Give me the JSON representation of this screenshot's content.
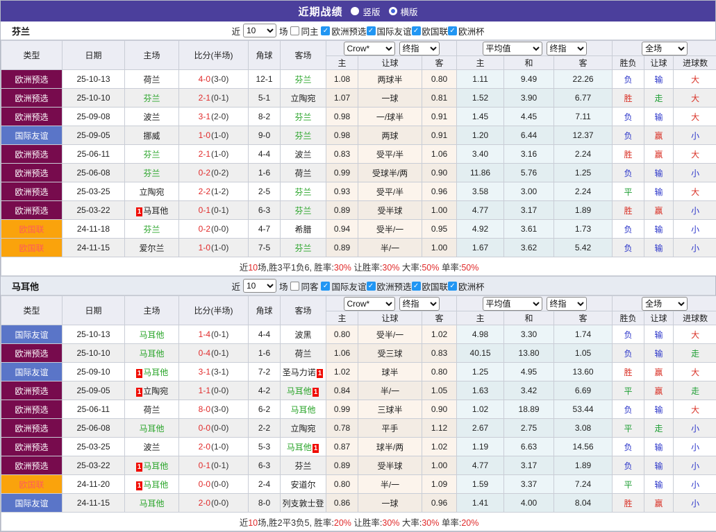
{
  "title_bar": {
    "title": "近期战绩",
    "layout_options": [
      {
        "label": "竖版",
        "selected": true
      },
      {
        "label": "横版",
        "selected": false
      }
    ]
  },
  "colors": {
    "bar_purple": "#4B3F9C",
    "league_maroon": "#770B4D",
    "league_blue": "#5A75C8",
    "league_orange": "#FAA30C",
    "league_orange_text": "#FF5B5B",
    "focus_team_green": "#28A428",
    "score_red": "#E02A2A",
    "win_red": "#D93025",
    "draw_green": "#1E9E33",
    "lose_blue": "#2B35C9",
    "checkbox_blue": "#2196F3"
  },
  "table_header": {
    "col_type": "类型",
    "col_date": "日期",
    "col_home": "主场",
    "col_score": "比分(半场)",
    "col_corner": "角球",
    "col_away": "客场",
    "dd_crow": "Crow*",
    "dd_final1": "终指",
    "dd_avg": "平均值",
    "dd_final2": "终指",
    "dd_fulltime": "全场",
    "sub": [
      "主",
      "让球",
      "客",
      "主",
      "和",
      "客",
      "胜负",
      "让球",
      "进球数"
    ]
  },
  "sections": [
    {
      "team": "芬兰",
      "filter": {
        "near_label": "近",
        "games_value": "10",
        "games_suffix": "场",
        "same_label": "同主",
        "same_checked": false,
        "leagues": [
          {
            "label": "欧洲预选",
            "checked": true
          },
          {
            "label": "国际友谊",
            "checked": true
          },
          {
            "label": "欧国联",
            "checked": true
          },
          {
            "label": "欧洲杯",
            "checked": true
          }
        ]
      },
      "rows": [
        {
          "league": "欧洲预选",
          "league_style": "maroon",
          "date": "25-10-13",
          "home": "荷兰",
          "home_focus": false,
          "home_card": 0,
          "score": "4-0",
          "half": "(3-0)",
          "corners": "12-1",
          "away": "芬兰",
          "away_focus": true,
          "away_card": 0,
          "crow": [
            "1.08",
            "两球半",
            "0.80"
          ],
          "avg": [
            "1.11",
            "9.49",
            "22.26"
          ],
          "outcome": [
            "负",
            "输",
            "大"
          ]
        },
        {
          "league": "欧洲预选",
          "league_style": "maroon",
          "date": "25-10-10",
          "home": "芬兰",
          "home_focus": true,
          "home_card": 0,
          "score": "2-1",
          "half": "(0-1)",
          "corners": "5-1",
          "away": "立陶宛",
          "away_focus": false,
          "away_card": 0,
          "crow": [
            "1.07",
            "一球",
            "0.81"
          ],
          "avg": [
            "1.52",
            "3.90",
            "6.77"
          ],
          "outcome": [
            "胜",
            "走",
            "大"
          ]
        },
        {
          "league": "欧洲预选",
          "league_style": "maroon",
          "date": "25-09-08",
          "home": "波兰",
          "home_focus": false,
          "home_card": 0,
          "score": "3-1",
          "half": "(2-0)",
          "corners": "8-2",
          "away": "芬兰",
          "away_focus": true,
          "away_card": 0,
          "crow": [
            "0.98",
            "一/球半",
            "0.91"
          ],
          "avg": [
            "1.45",
            "4.45",
            "7.11"
          ],
          "outcome": [
            "负",
            "输",
            "大"
          ]
        },
        {
          "league": "国际友谊",
          "league_style": "blue",
          "date": "25-09-05",
          "home": "挪威",
          "home_focus": false,
          "home_card": 0,
          "score": "1-0",
          "half": "(1-0)",
          "corners": "9-0",
          "away": "芬兰",
          "away_focus": true,
          "away_card": 0,
          "crow": [
            "0.98",
            "两球",
            "0.91"
          ],
          "avg": [
            "1.20",
            "6.44",
            "12.37"
          ],
          "outcome": [
            "负",
            "赢",
            "小"
          ]
        },
        {
          "league": "欧洲预选",
          "league_style": "maroon",
          "date": "25-06-11",
          "home": "芬兰",
          "home_focus": true,
          "home_card": 0,
          "score": "2-1",
          "half": "(1-0)",
          "corners": "4-4",
          "away": "波兰",
          "away_focus": false,
          "away_card": 0,
          "crow": [
            "0.83",
            "受平/半",
            "1.06"
          ],
          "avg": [
            "3.40",
            "3.16",
            "2.24"
          ],
          "outcome": [
            "胜",
            "赢",
            "大"
          ]
        },
        {
          "league": "欧洲预选",
          "league_style": "maroon",
          "date": "25-06-08",
          "home": "芬兰",
          "home_focus": true,
          "home_card": 0,
          "score": "0-2",
          "half": "(0-2)",
          "corners": "1-6",
          "away": "荷兰",
          "away_focus": false,
          "away_card": 0,
          "crow": [
            "0.99",
            "受球半/两",
            "0.90"
          ],
          "avg": [
            "11.86",
            "5.76",
            "1.25"
          ],
          "outcome": [
            "负",
            "输",
            "小"
          ]
        },
        {
          "league": "欧洲预选",
          "league_style": "maroon",
          "date": "25-03-25",
          "home": "立陶宛",
          "home_focus": false,
          "home_card": 0,
          "score": "2-2",
          "half": "(1-2)",
          "corners": "2-5",
          "away": "芬兰",
          "away_focus": true,
          "away_card": 0,
          "crow": [
            "0.93",
            "受平/半",
            "0.96"
          ],
          "avg": [
            "3.58",
            "3.00",
            "2.24"
          ],
          "outcome": [
            "平",
            "输",
            "大"
          ]
        },
        {
          "league": "欧洲预选",
          "league_style": "maroon",
          "date": "25-03-22",
          "home": "马耳他",
          "home_focus": false,
          "home_card": 1,
          "score": "0-1",
          "half": "(0-1)",
          "corners": "6-3",
          "away": "芬兰",
          "away_focus": true,
          "away_card": 0,
          "crow": [
            "0.89",
            "受半球",
            "1.00"
          ],
          "avg": [
            "4.77",
            "3.17",
            "1.89"
          ],
          "outcome": [
            "胜",
            "赢",
            "小"
          ]
        },
        {
          "league": "欧国联",
          "league_style": "orange",
          "date": "24-11-18",
          "home": "芬兰",
          "home_focus": true,
          "home_card": 0,
          "score": "0-2",
          "half": "(0-0)",
          "corners": "4-7",
          "away": "希腊",
          "away_focus": false,
          "away_card": 0,
          "crow": [
            "0.94",
            "受半/一",
            "0.95"
          ],
          "avg": [
            "4.92",
            "3.61",
            "1.73"
          ],
          "outcome": [
            "负",
            "输",
            "小"
          ]
        },
        {
          "league": "欧国联",
          "league_style": "orange",
          "date": "24-11-15",
          "home": "爱尔兰",
          "home_focus": false,
          "home_card": 0,
          "score": "1-0",
          "half": "(1-0)",
          "corners": "7-5",
          "away": "芬兰",
          "away_focus": true,
          "away_card": 0,
          "crow": [
            "0.89",
            "半/一",
            "1.00"
          ],
          "avg": [
            "1.67",
            "3.62",
            "5.42"
          ],
          "outcome": [
            "负",
            "输",
            "小"
          ]
        }
      ],
      "summary": [
        [
          "近",
          false
        ],
        [
          "10",
          true
        ],
        [
          "场,胜3平1负6, 胜率:",
          false
        ],
        [
          "30%",
          true
        ],
        [
          " 让胜率:",
          false
        ],
        [
          "30%",
          true
        ],
        [
          " 大率:",
          false
        ],
        [
          "50%",
          true
        ],
        [
          " 单率:",
          false
        ],
        [
          "50%",
          true
        ]
      ]
    },
    {
      "team": "马耳他",
      "filter": {
        "near_label": "近",
        "games_value": "10",
        "games_suffix": "场",
        "same_label": "同客",
        "same_checked": false,
        "leagues": [
          {
            "label": "国际友谊",
            "checked": true
          },
          {
            "label": "欧洲预选",
            "checked": true
          },
          {
            "label": "欧国联",
            "checked": true
          },
          {
            "label": "欧洲杯",
            "checked": true
          }
        ]
      },
      "rows": [
        {
          "league": "国际友谊",
          "league_style": "blue",
          "date": "25-10-13",
          "home": "马耳他",
          "home_focus": true,
          "home_card": 0,
          "score": "1-4",
          "half": "(0-1)",
          "corners": "4-4",
          "away": "波黑",
          "away_focus": false,
          "away_card": 0,
          "crow": [
            "0.80",
            "受半/一",
            "1.02"
          ],
          "avg": [
            "4.98",
            "3.30",
            "1.74"
          ],
          "outcome": [
            "负",
            "输",
            "大"
          ]
        },
        {
          "league": "欧洲预选",
          "league_style": "maroon",
          "date": "25-10-10",
          "home": "马耳他",
          "home_focus": true,
          "home_card": 0,
          "score": "0-4",
          "half": "(0-1)",
          "corners": "1-6",
          "away": "荷兰",
          "away_focus": false,
          "away_card": 0,
          "crow": [
            "1.06",
            "受三球",
            "0.83"
          ],
          "avg": [
            "40.15",
            "13.80",
            "1.05"
          ],
          "outcome": [
            "负",
            "输",
            "走"
          ]
        },
        {
          "league": "国际友谊",
          "league_style": "blue",
          "date": "25-09-10",
          "home": "马耳他",
          "home_focus": true,
          "home_card": 1,
          "score": "3-1",
          "half": "(3-1)",
          "corners": "7-2",
          "away": "圣马力诺",
          "away_focus": false,
          "away_card": 1,
          "crow": [
            "1.02",
            "球半",
            "0.80"
          ],
          "avg": [
            "1.25",
            "4.95",
            "13.60"
          ],
          "outcome": [
            "胜",
            "赢",
            "大"
          ]
        },
        {
          "league": "欧洲预选",
          "league_style": "maroon",
          "date": "25-09-05",
          "home": "立陶宛",
          "home_focus": false,
          "home_card": 1,
          "score": "1-1",
          "half": "(0-0)",
          "corners": "4-2",
          "away": "马耳他",
          "away_focus": true,
          "away_card": 1,
          "crow": [
            "0.84",
            "半/一",
            "1.05"
          ],
          "avg": [
            "1.63",
            "3.42",
            "6.69"
          ],
          "outcome": [
            "平",
            "赢",
            "走"
          ]
        },
        {
          "league": "欧洲预选",
          "league_style": "maroon",
          "date": "25-06-11",
          "home": "荷兰",
          "home_focus": false,
          "home_card": 0,
          "score": "8-0",
          "half": "(3-0)",
          "corners": "6-2",
          "away": "马耳他",
          "away_focus": true,
          "away_card": 0,
          "crow": [
            "0.99",
            "三球半",
            "0.90"
          ],
          "avg": [
            "1.02",
            "18.89",
            "53.44"
          ],
          "outcome": [
            "负",
            "输",
            "大"
          ]
        },
        {
          "league": "欧洲预选",
          "league_style": "maroon",
          "date": "25-06-08",
          "home": "马耳他",
          "home_focus": true,
          "home_card": 0,
          "score": "0-0",
          "half": "(0-0)",
          "corners": "2-2",
          "away": "立陶宛",
          "away_focus": false,
          "away_card": 0,
          "crow": [
            "0.78",
            "平手",
            "1.12"
          ],
          "avg": [
            "2.67",
            "2.75",
            "3.08"
          ],
          "outcome": [
            "平",
            "走",
            "小"
          ]
        },
        {
          "league": "欧洲预选",
          "league_style": "maroon",
          "date": "25-03-25",
          "home": "波兰",
          "home_focus": false,
          "home_card": 0,
          "score": "2-0",
          "half": "(1-0)",
          "corners": "5-3",
          "away": "马耳他",
          "away_focus": true,
          "away_card": 1,
          "crow": [
            "0.87",
            "球半/两",
            "1.02"
          ],
          "avg": [
            "1.19",
            "6.63",
            "14.56"
          ],
          "outcome": [
            "负",
            "输",
            "小"
          ]
        },
        {
          "league": "欧洲预选",
          "league_style": "maroon",
          "date": "25-03-22",
          "home": "马耳他",
          "home_focus": true,
          "home_card": 1,
          "score": "0-1",
          "half": "(0-1)",
          "corners": "6-3",
          "away": "芬兰",
          "away_focus": false,
          "away_card": 0,
          "crow": [
            "0.89",
            "受半球",
            "1.00"
          ],
          "avg": [
            "4.77",
            "3.17",
            "1.89"
          ],
          "outcome": [
            "负",
            "输",
            "小"
          ]
        },
        {
          "league": "欧国联",
          "league_style": "orange",
          "date": "24-11-20",
          "home": "马耳他",
          "home_focus": true,
          "home_card": 1,
          "score": "0-0",
          "half": "(0-0)",
          "corners": "2-4",
          "away": "安道尔",
          "away_focus": false,
          "away_card": 0,
          "crow": [
            "0.80",
            "半/一",
            "1.09"
          ],
          "avg": [
            "1.59",
            "3.37",
            "7.24"
          ],
          "outcome": [
            "平",
            "输",
            "小"
          ]
        },
        {
          "league": "国际友谊",
          "league_style": "blue",
          "date": "24-11-15",
          "home": "马耳他",
          "home_focus": true,
          "home_card": 0,
          "score": "2-0",
          "half": "(0-0)",
          "corners": "8-0",
          "away": "列支敦士登",
          "away_focus": false,
          "away_card": 0,
          "crow": [
            "0.86",
            "一球",
            "0.96"
          ],
          "avg": [
            "1.41",
            "4.00",
            "8.04"
          ],
          "outcome": [
            "胜",
            "赢",
            "小"
          ]
        }
      ],
      "summary": [
        [
          "近",
          false
        ],
        [
          "10",
          true
        ],
        [
          "场,胜2平3负5, 胜率:",
          false
        ],
        [
          "20%",
          true
        ],
        [
          " 让胜率:",
          false
        ],
        [
          "30%",
          true
        ],
        [
          " 大率:",
          false
        ],
        [
          "30%",
          true
        ],
        [
          " 单率:",
          false
        ],
        [
          "20%",
          true
        ]
      ]
    }
  ]
}
